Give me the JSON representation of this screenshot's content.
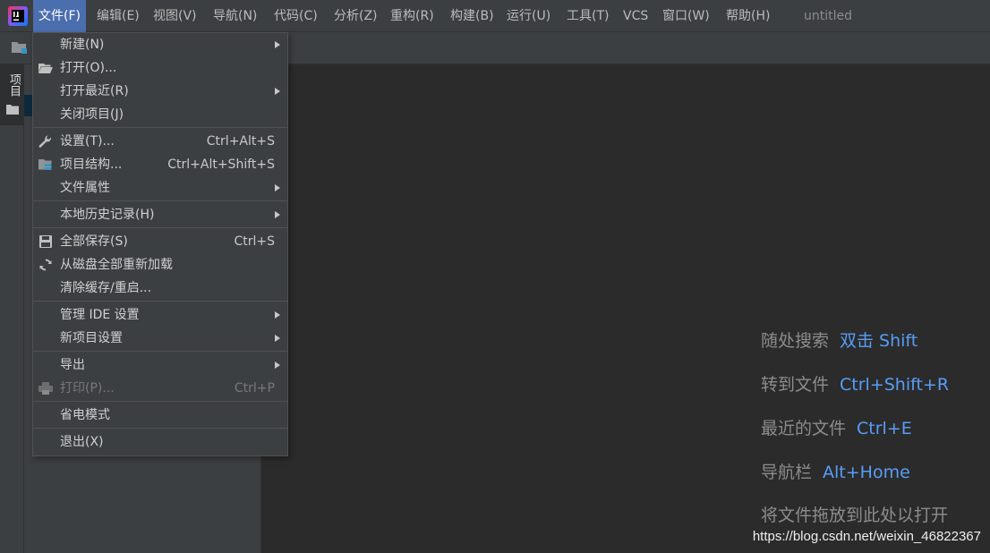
{
  "menubar": {
    "items": [
      {
        "label": "文件(F)",
        "active": true
      },
      {
        "label": "编辑(E)"
      },
      {
        "label": "视图(V)"
      },
      {
        "label": "导航(N)"
      },
      {
        "label": "代码(C)"
      },
      {
        "label": "分析(Z)"
      },
      {
        "label": "重构(R)"
      },
      {
        "label": "构建(B)"
      },
      {
        "label": "运行(U)"
      },
      {
        "label": "工具(T)"
      },
      {
        "label": "VCS"
      },
      {
        "label": "窗口(W)"
      },
      {
        "label": "帮助(H)"
      }
    ],
    "window_title": "untitled"
  },
  "sidebar": {
    "project_tab_label": "项目"
  },
  "file_menu": {
    "new": {
      "label": "新建(N)",
      "submenu": true
    },
    "open": {
      "label": "打开(O)...",
      "icon": "folder-open-icon"
    },
    "open_recent": {
      "label": "打开最近(R)",
      "submenu": true
    },
    "close_project": {
      "label": "关闭项目(J)"
    },
    "settings": {
      "label": "设置(T)...",
      "shortcut": "Ctrl+Alt+S",
      "icon": "wrench-icon"
    },
    "project_structure": {
      "label": "项目结构...",
      "shortcut": "Ctrl+Alt+Shift+S",
      "icon": "project-structure-icon"
    },
    "file_properties": {
      "label": "文件属性",
      "submenu": true
    },
    "local_history": {
      "label": "本地历史记录(H)",
      "submenu": true
    },
    "save_all": {
      "label": "全部保存(S)",
      "shortcut": "Ctrl+S",
      "icon": "save-icon"
    },
    "reload": {
      "label": "从磁盘全部重新加载",
      "icon": "refresh-icon"
    },
    "invalidate_caches": {
      "label": "清除缓存/重启..."
    },
    "manage_ide_settings": {
      "label": "管理 IDE 设置",
      "submenu": true
    },
    "new_project_settings": {
      "label": "新项目设置",
      "submenu": true
    },
    "export": {
      "label": "导出",
      "submenu": true
    },
    "print": {
      "label": "打印(P)...",
      "shortcut": "Ctrl+P",
      "icon": "print-icon",
      "disabled": true
    },
    "power_save": {
      "label": "省电模式"
    },
    "exit": {
      "label": "退出(X)"
    }
  },
  "editor": {
    "hints": [
      {
        "label": "随处搜索",
        "key": "双击 Shift"
      },
      {
        "label": "转到文件",
        "key": "Ctrl+Shift+R"
      },
      {
        "label": "最近的文件",
        "key": "Ctrl+E"
      },
      {
        "label": "导航栏",
        "key": "Alt+Home"
      },
      {
        "label": "将文件拖放到此处以打开",
        "key": ""
      }
    ]
  },
  "watermark": "https://blog.csdn.net/weixin_46822367",
  "colors": {
    "background": "#2b2b2b",
    "panel": "#3c3f41",
    "menu_active": "#4b6eaf",
    "shortcut_hint": "#589df6"
  }
}
